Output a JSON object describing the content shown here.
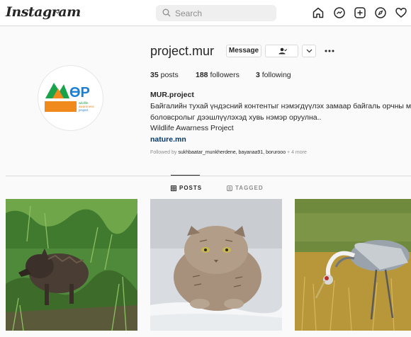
{
  "topbar": {
    "logo": "Instagram",
    "search_placeholder": "Search",
    "icons": [
      "home-icon",
      "messenger-icon",
      "new-post-icon",
      "explore-icon",
      "activity-heart-icon"
    ]
  },
  "profile": {
    "username": "project.mur",
    "message_label": "Message",
    "stats": {
      "posts": "35",
      "posts_label": "posts",
      "followers": "188",
      "followers_label": "followers",
      "following": "3",
      "following_label": "following"
    },
    "display_name": "MUR.project",
    "bio_lines": [
      "Байгалийн тухай үндэсний контентыг нэмэгдүүлэх замаар байгаль орчны мэдлэг",
      "боловсролыг дээшлүүлэхэд хувь нэмэр оруулна..",
      "Wildlife Awarness Project"
    ],
    "website": "nature.mn",
    "followed_by_prefix": "Followed by",
    "followed_by_users": "sukhbaatar_munkherdene, bayanaa91, boruroоо",
    "followed_by_more": "+ 4 more",
    "avatar_logo_text": "MOP",
    "avatar_logo_subtext": "wildlife awareness project"
  },
  "tabs": {
    "posts": "POSTS",
    "tagged": "TAGGED"
  },
  "posts": [
    {
      "subject": "wild boar in green grass"
    },
    {
      "subject": "pallas cat on snow"
    },
    {
      "subject": "white-naped crane in dry grass"
    }
  ],
  "colors": {
    "link": "#00376b",
    "accent_green": "#1aa34a",
    "accent_blue": "#1b7fd6",
    "accent_orange": "#f08a1c"
  }
}
